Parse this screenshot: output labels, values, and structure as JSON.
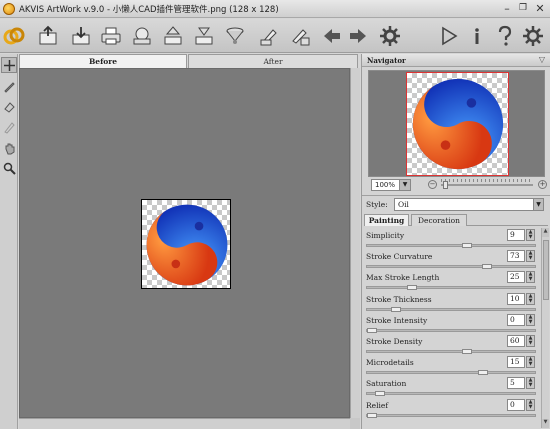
{
  "window": {
    "title": "AKVIS ArtWork v.9.0 - 小懒人CAD插件管理软件.png (128 x 128)",
    "minimize": "–",
    "restore": "❐",
    "close": "✕"
  },
  "toolbar": {
    "icons": [
      "logo-icon",
      "open-icon",
      "save-icon",
      "print-icon",
      "share-icon",
      "export-icon",
      "import-icon",
      "presets-icon",
      "batch-icon",
      "batch-export-icon",
      "undo-icon",
      "redo-icon",
      "settings-gear-icon",
      "run-icon",
      "info-icon",
      "help-icon",
      "preferences-icon"
    ]
  },
  "view_tabs": {
    "before": "Before",
    "after": "After"
  },
  "navigator": {
    "title": "Navigator",
    "zoom": "100%",
    "zoom_minus": "−",
    "zoom_plus": "+",
    "zoom_level": 0.02
  },
  "style": {
    "label": "Style:",
    "value": "Oil"
  },
  "panel_tabs": {
    "painting": "Painting",
    "decoration": "Decoration"
  },
  "params": [
    {
      "label": "Simplicity",
      "value": "9",
      "level": 0.6
    },
    {
      "label": "Stroke Curvature",
      "value": "73",
      "level": 0.73
    },
    {
      "label": "Max Stroke Length",
      "value": "25",
      "level": 0.25
    },
    {
      "label": "Stroke Thickness",
      "value": "10",
      "level": 0.15
    },
    {
      "label": "Stroke Intensity",
      "value": "0",
      "level": 0.0
    },
    {
      "label": "Stroke Density",
      "value": "60",
      "level": 0.6
    },
    {
      "label": "Microdetails",
      "value": "15",
      "level": 0.7
    },
    {
      "label": "Saturation",
      "value": "5",
      "level": 0.05
    },
    {
      "label": "Relief",
      "value": "0",
      "level": 0.0
    }
  ],
  "colors": {
    "canvas_bg": "#7a7a7a",
    "yin_red": "#e04a1a",
    "yang_blue": "#1f4fd6"
  }
}
